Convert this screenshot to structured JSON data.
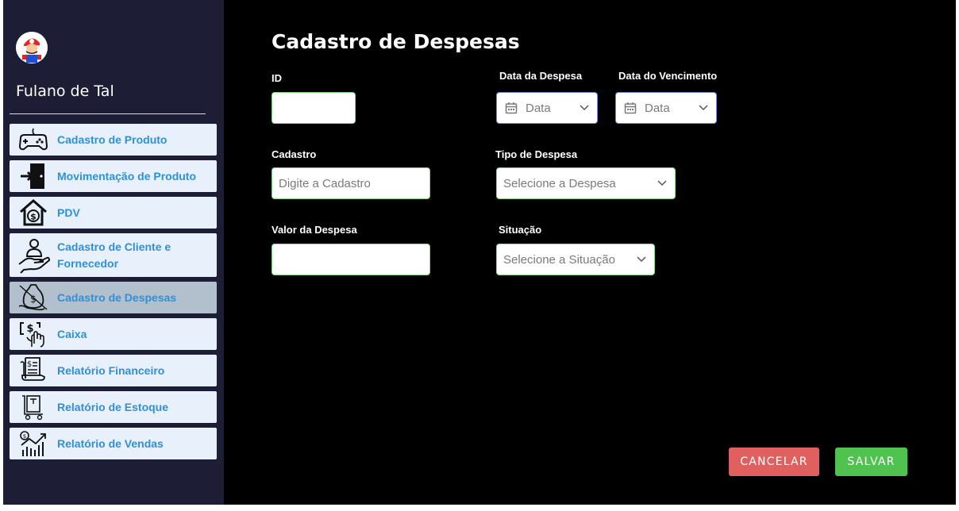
{
  "user": {
    "name": "Fulano de Tal"
  },
  "menu": {
    "items": [
      {
        "label": "Cadastro de Produto",
        "icon": "gamepad-icon"
      },
      {
        "label": "Movimentação de Produto",
        "icon": "door-enter-icon"
      },
      {
        "label": "PDV",
        "icon": "house-dollar-icon"
      },
      {
        "label": "Cadastro de Cliente e Fornecedor",
        "icon": "hand-person-icon"
      },
      {
        "label": "Cadastro de Despesas",
        "icon": "money-bag-hand-icon",
        "active": true
      },
      {
        "label": "Caixa",
        "icon": "cash-hand-icon"
      },
      {
        "label": "Relatório Financeiro",
        "icon": "financial-report-icon"
      },
      {
        "label": "Relatório de Estoque",
        "icon": "stock-cart-icon"
      },
      {
        "label": "Relatório de Vendas",
        "icon": "sales-chart-icon"
      }
    ]
  },
  "page": {
    "title": "Cadastro de Despesas"
  },
  "form": {
    "id_label": "ID",
    "id_value": "",
    "data_despesa_label": "Data da Despesa",
    "data_despesa_placeholder": "Data",
    "data_vencimento_label": "Data do Vencimento",
    "data_vencimento_placeholder": "Data",
    "cadastro_label": "Cadastro",
    "cadastro_placeholder": "Digite a Cadastro",
    "tipo_label": "Tipo de Despesa",
    "tipo_value": "Selecione a Despesa",
    "valor_label": "Valor da Despesa",
    "valor_value": "",
    "situacao_label": "Situação",
    "situacao_value": "Selecione a Situação"
  },
  "actions": {
    "cancel": "CANCELAR",
    "save": "SALVAR"
  },
  "colors": {
    "sidebar_bg": "#1d1d35",
    "main_bg": "#000000",
    "menu_item_bg": "#e8f1fb",
    "menu_active_bg": "#b2c0cd",
    "menu_text": "#2f8fd8",
    "cancel": "#e06060",
    "save": "#4fc24f"
  }
}
